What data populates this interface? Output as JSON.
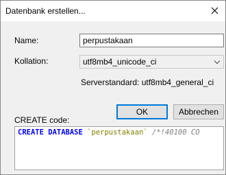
{
  "dialog": {
    "title": "Datenbank erstellen...",
    "close_icon": "close-icon"
  },
  "form": {
    "name_label": "Name:",
    "name_value": "perpustakaan",
    "collation_label": "Kollation:",
    "collation_value": "utf8mb4_unicode_ci",
    "server_default": "Serverstandard: utf8mb4_general_ci"
  },
  "buttons": {
    "ok": "OK",
    "cancel": "Abbrechen"
  },
  "code": {
    "label": "CREATE code:",
    "keyword": "CREATE DATABASE",
    "identifier": "`perpustakaan`",
    "comment": "/*!40100 CO"
  },
  "colors": {
    "keyword": "#0000ff",
    "identifier": "#808000",
    "comment": "#808080",
    "ok_border": "#0078d7"
  }
}
